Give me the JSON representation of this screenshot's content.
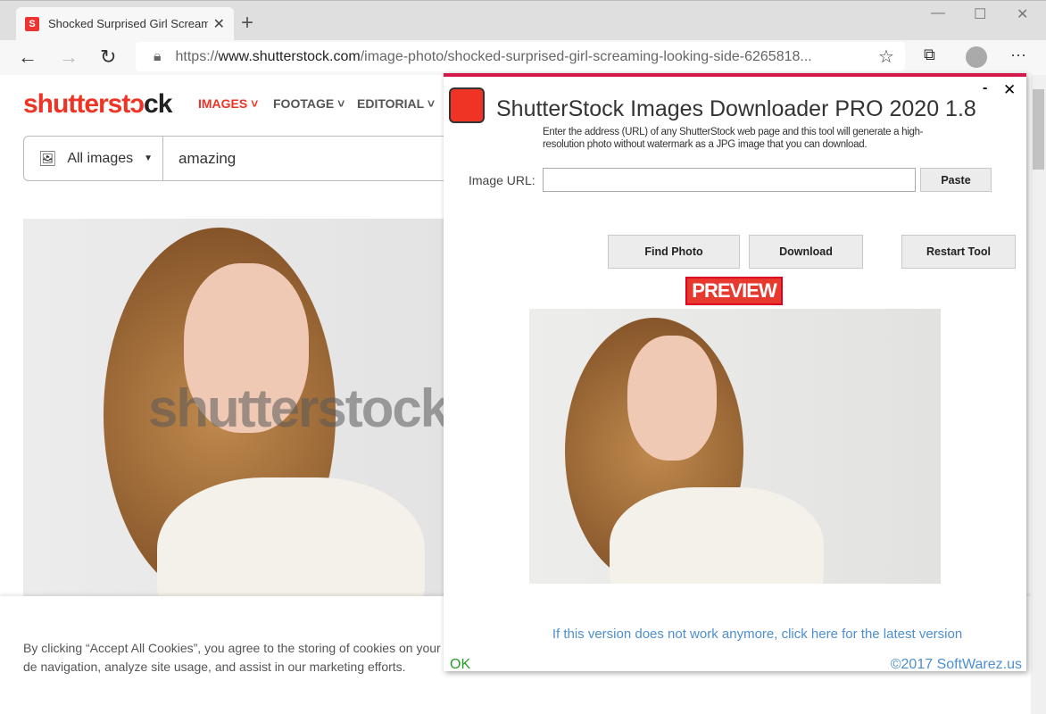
{
  "browser": {
    "tab_title": "Shocked Surprised Girl Screaming Looking Side",
    "url_prefix": "https://",
    "url_host": "www.shutterstock.com",
    "url_path": "/image-photo/shocked-surprised-girl-screaming-looking-side-6265818..."
  },
  "site": {
    "logo_a": "shutterst",
    "logo_b": "ɔ",
    "logo_c": "ck",
    "menu": [
      "IMAGES",
      "FOOTAGE",
      "EDITORIAL"
    ],
    "search_category": "All images",
    "search_query": "amazing",
    "watermark": "shutterstock",
    "cookie_text": "By clicking “Accept All Cookies”, you agree to the storing of cookies on your de navigation, analyze site usage, and assist in our marketing efforts."
  },
  "dialog": {
    "title": "ShutterStock Images Downloader PRO 2020 1.8",
    "description": "Enter the address (URL) of any ShutterStock web page and this tool will generate a high-resolution photo without watermark as a JPG image that you can download.",
    "url_label": "Image URL:",
    "url_value": "",
    "paste": "Paste",
    "find": "Find Photo",
    "download": "Download",
    "restart": "Restart Tool",
    "preview": "PREVIEW",
    "link": "If this version does not work anymore, click here for the latest version",
    "ok": "OK",
    "copyright": "©2017 SoftWarez.us"
  },
  "colors": {
    "brand": "#ef3426",
    "dialog_border": "#d4184b",
    "link": "#4d8fcf",
    "ok": "#2a9a2a"
  }
}
